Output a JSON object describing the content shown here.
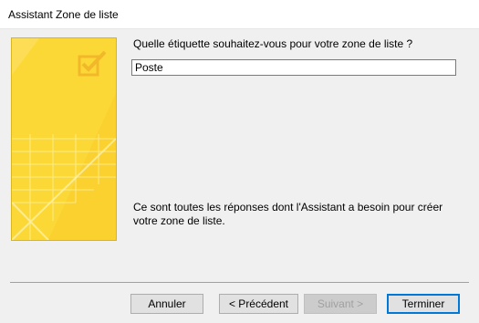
{
  "window": {
    "title": "Assistant Zone de liste"
  },
  "main": {
    "question": "Quelle étiquette souhaitez-vous pour votre zone de liste ?",
    "label_value": "Poste",
    "info_line1": "Ce sont toutes les réponses dont l'Assistant a besoin pour créer",
    "info_line2": "votre zone de liste."
  },
  "buttons": {
    "cancel": "Annuler",
    "previous": "< Précédent",
    "next": "Suivant >",
    "finish": "Terminer"
  },
  "colors": {
    "banner": "#fcd837",
    "focus_border": "#0078d7",
    "disabled_text": "#a0a0a0"
  },
  "icons": {
    "banner_check": "checkbox-check-icon"
  }
}
